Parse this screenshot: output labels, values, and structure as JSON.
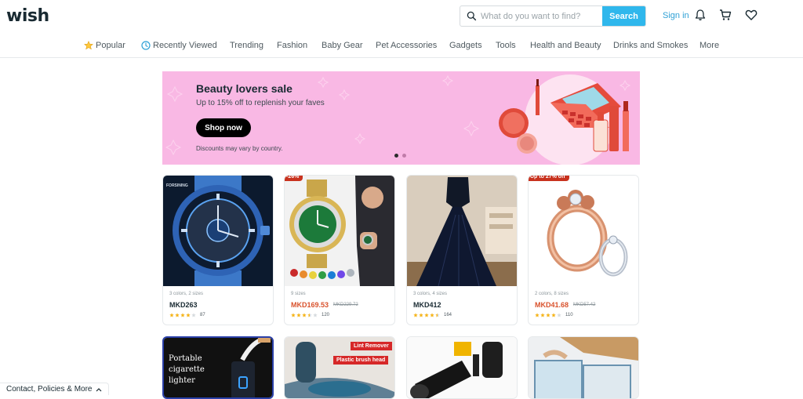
{
  "header": {
    "logo": "wish",
    "search": {
      "placeholder": "What do you want to find?",
      "button_label": "Search"
    },
    "sign_in_label": "Sign in",
    "icons": [
      "bell-icon",
      "cart-icon",
      "heart-icon"
    ]
  },
  "nav": {
    "items": [
      {
        "label": "Popular",
        "icon": "star-icon"
      },
      {
        "label": "Recently Viewed",
        "icon": "clock-icon"
      },
      {
        "label": "Trending"
      },
      {
        "label": "Fashion"
      },
      {
        "label": "Baby Gear"
      },
      {
        "label": "Pet Accessories"
      },
      {
        "label": "Gadgets"
      },
      {
        "label": "Tools"
      },
      {
        "label": "Health and Beauty"
      },
      {
        "label": "Drinks and Smokes"
      },
      {
        "label": "More"
      }
    ]
  },
  "banner": {
    "title": "Beauty lovers sale",
    "subtitle": "Up to 15% off to replenish your faves",
    "button_label": "Shop now",
    "note": "Discounts may vary by country.",
    "background_color": "#f9b8e4",
    "slides": 2,
    "active_slide": 1
  },
  "products": [
    {
      "meta": "3 colors, 2 sizes",
      "price": "MKD263",
      "old_price": "",
      "rating": 4,
      "rating_count": "87",
      "badge": "",
      "image_label": "FORSINING"
    },
    {
      "meta": "9 sizes",
      "price": "MKD169.53",
      "old_price": "MKD229.72",
      "rating": 3.5,
      "rating_count": "120",
      "badge": "-26%"
    },
    {
      "meta": "3 colors, 4 sizes",
      "price": "MKD412",
      "old_price": "",
      "rating": 4.5,
      "rating_count": "164",
      "badge": ""
    },
    {
      "meta": "2 colors, 8 sizes",
      "price": "MKD41.68",
      "old_price": "MKD57.42",
      "rating": 4,
      "rating_count": "110",
      "badge": "Up to 27% off"
    }
  ],
  "products_row2": [
    {
      "image_text": "Portable cigarette lighter"
    },
    {
      "image_text_1": "Lint Remover",
      "image_text_2": "Plastic brush head"
    },
    {
      "image_text": ""
    },
    {
      "image_text": ""
    }
  ],
  "footer": {
    "link_label": "Contact, Policies & More"
  },
  "colors": {
    "accent": "#2fb7ec",
    "sale": "#d9522c",
    "badge": "#c8321e",
    "star": "#f5b41a"
  }
}
